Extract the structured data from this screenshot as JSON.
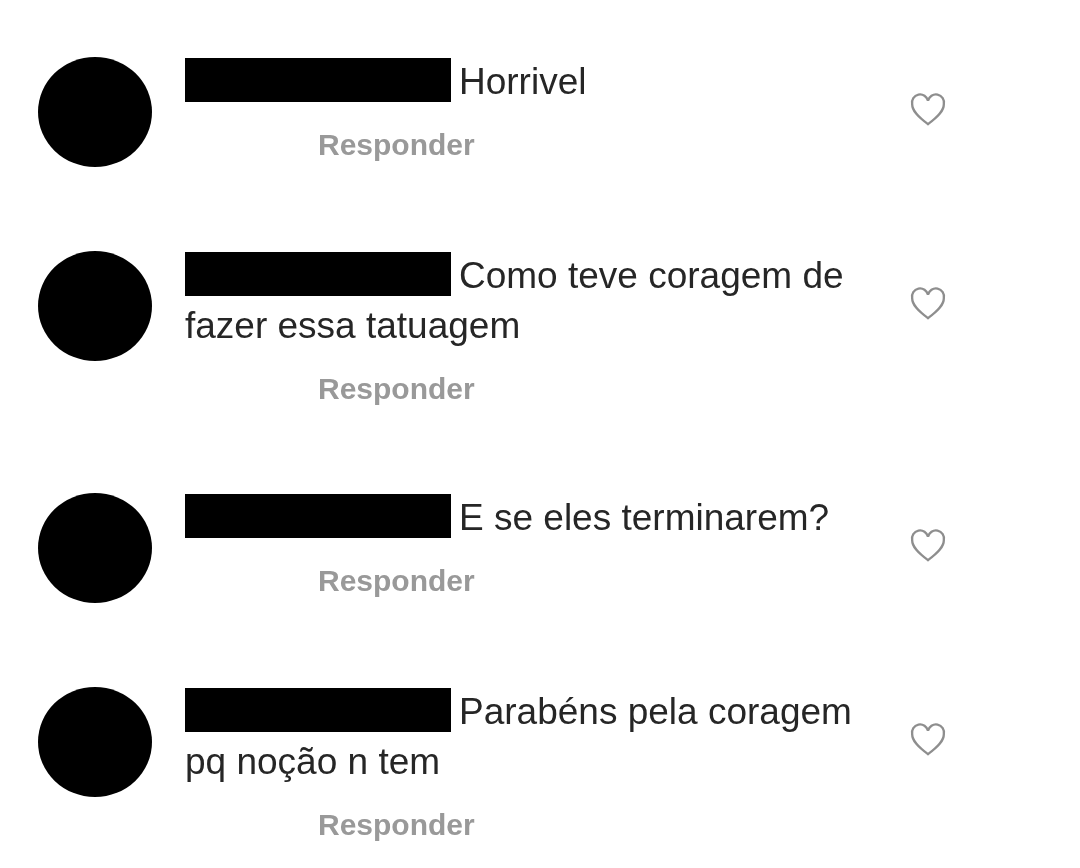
{
  "comments": [
    {
      "text": "Horrivel",
      "reply": "Responder",
      "liked": false
    },
    {
      "text": "Como teve coragem de fazer essa tatuagem",
      "reply": "Responder",
      "liked": false
    },
    {
      "text": "E se eles terminarem?",
      "reply": "Responder",
      "liked": false
    },
    {
      "text": "Parabéns pela coragem pq noção n tem",
      "reply": "Responder",
      "liked": false
    }
  ]
}
